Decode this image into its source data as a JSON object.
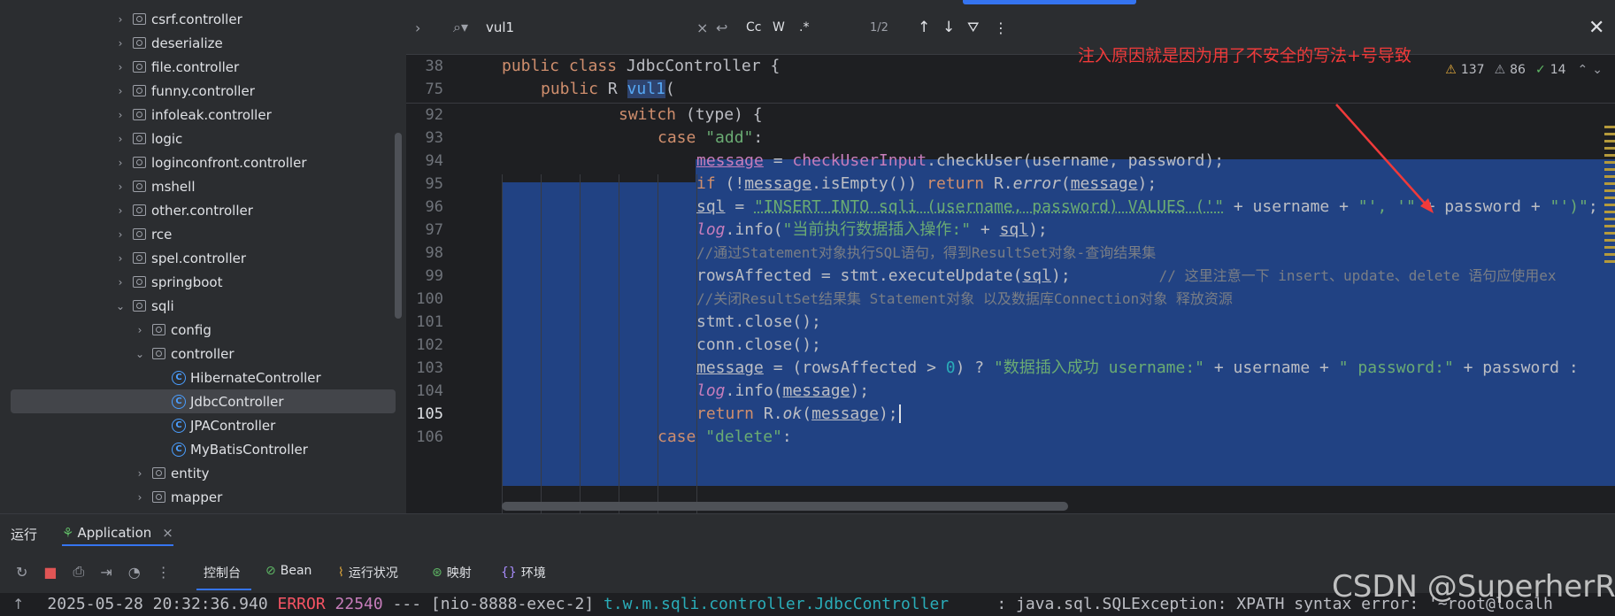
{
  "tree": {
    "items": [
      {
        "label": "csrf.controller",
        "kind": "package",
        "expanded": false
      },
      {
        "label": "deserialize",
        "kind": "package",
        "expanded": false
      },
      {
        "label": "file.controller",
        "kind": "package",
        "expanded": false
      },
      {
        "label": "funny.controller",
        "kind": "package",
        "expanded": false
      },
      {
        "label": "infoleak.controller",
        "kind": "package",
        "expanded": false
      },
      {
        "label": "logic",
        "kind": "package",
        "expanded": false
      },
      {
        "label": "loginconfront.controller",
        "kind": "package",
        "expanded": false
      },
      {
        "label": "mshell",
        "kind": "package",
        "expanded": false
      },
      {
        "label": "other.controller",
        "kind": "package",
        "expanded": false
      },
      {
        "label": "rce",
        "kind": "package",
        "expanded": false
      },
      {
        "label": "spel.controller",
        "kind": "package",
        "expanded": false
      },
      {
        "label": "springboot",
        "kind": "package",
        "expanded": false
      },
      {
        "label": "sqli",
        "kind": "package",
        "expanded": true
      },
      {
        "label": "config",
        "kind": "package",
        "expanded": false
      },
      {
        "label": "controller",
        "kind": "package",
        "expanded": true
      },
      {
        "label": "HibernateController",
        "kind": "class"
      },
      {
        "label": "JdbcController",
        "kind": "class",
        "selected": true
      },
      {
        "label": "JPAController",
        "kind": "class"
      },
      {
        "label": "MyBatisController",
        "kind": "class"
      },
      {
        "label": "entity",
        "kind": "package",
        "expanded": false
      },
      {
        "label": "mapper",
        "kind": "package",
        "expanded": false
      }
    ]
  },
  "search": {
    "query": "vul1",
    "count": "1/2",
    "option_case": "Cc",
    "option_word": "W",
    "option_regex": ".*"
  },
  "inspections": {
    "warnings": "137",
    "weak": "86",
    "ok": "14"
  },
  "annotation": "注入原因就是因为用了不安全的写法+号导致",
  "editor": {
    "lines": [
      {
        "num": "38"
      },
      {
        "num": "75"
      },
      {
        "num": "92"
      },
      {
        "num": "93"
      },
      {
        "num": "94"
      },
      {
        "num": "95"
      },
      {
        "num": "96"
      },
      {
        "num": "97"
      },
      {
        "num": "98"
      },
      {
        "num": "99"
      },
      {
        "num": "100"
      },
      {
        "num": "101"
      },
      {
        "num": "102"
      },
      {
        "num": "103"
      },
      {
        "num": "104"
      },
      {
        "num": "105"
      },
      {
        "num": "106"
      }
    ],
    "code": {
      "l38a": "public class ",
      "l38b": "JdbcController {",
      "l75a": "public ",
      "l75b": "R ",
      "l75c": "vul1",
      "l75d": "(",
      "l92a": "switch ",
      "l92b": "(type) {",
      "l93a": "case ",
      "l93b": "\"add\"",
      "l93c": ":",
      "l94a": "message",
      "l94b": " = ",
      "l94c": "checkUserInput",
      "l94d": ".checkUser(username, password);",
      "l95a": "if ",
      "l95b": "(!",
      "l95c": "message",
      "l95d": ".isEmpty()) ",
      "l95e": "return ",
      "l95f": "R.",
      "l95g": "error",
      "l95h": "(",
      "l95i": "message",
      "l95j": ");",
      "l96a": "sql",
      " l96b": " = ",
      "l96c": "\"INSERT INTO sqli (username, password) VALUES ('\"",
      "l96d": " + username + ",
      "l96e": "\"', '\"",
      "l96f": " + password + ",
      "l96g": "\"')\"",
      "l96h": ";",
      "l97a": "log",
      "l97b": ".info(",
      "l97c": "\"当前执行数据插入操作:\"",
      "l97d": " + ",
      "l97e": "sql",
      "l97f": ");",
      "l98": "//通过Statement对象执行SQL语句，得到ResultSet对象-查询结果集",
      "l99a": "rowsAffected = stmt.executeUpdate(",
      "l99b": "sql",
      "l99c": ");",
      "l99d": "// 这里注意一下 insert、update、delete 语句应使用ex",
      "l100": "//关闭ResultSet结果集 Statement对象 以及数据库Connection对象 释放资源",
      "l101": "stmt.close();",
      "l102": "conn.close();",
      "l103a": "message",
      "l103b": " = (rowsAffected > ",
      "l103c": "0",
      "l103d": ") ? ",
      "l103e": "\"数据插入成功 username:\"",
      "l103f": " + username + ",
      "l103g": "\" password:\"",
      "l103h": " + password : ",
      "l104a": "log",
      "l104b": ".info(",
      "l104c": "message",
      "l104d": ");",
      "l105a": "return ",
      "l105b": "R.",
      "l105c": "ok",
      "l105d": "(",
      "l105e": "message",
      "l105f": ");",
      "l106a": "case ",
      "l106b": "\"delete\"",
      "l106c": ":"
    }
  },
  "run": {
    "tab_label": "运行",
    "app_tab": "Application",
    "subtabs": [
      "控制台",
      "Bean",
      "运行状况",
      "映射",
      "环境"
    ]
  },
  "console": {
    "timestamp": "2025-05-28 20:32:36.940",
    "level": "ERROR",
    "pid": "22540",
    "sep": "---",
    "thread": "[nio-8888-exec-2]",
    "logger": "t.w.m.sqli.controller.JdbcController",
    "message": "     : java.sql.SQLException: XPATH syntax error: '~root@localh"
  },
  "watermark": "CSDN @SuperherRo",
  "colors": {
    "accent": "#3574f0",
    "selection": "#214283",
    "annotation": "#f03a3a",
    "error": "#f75464"
  }
}
